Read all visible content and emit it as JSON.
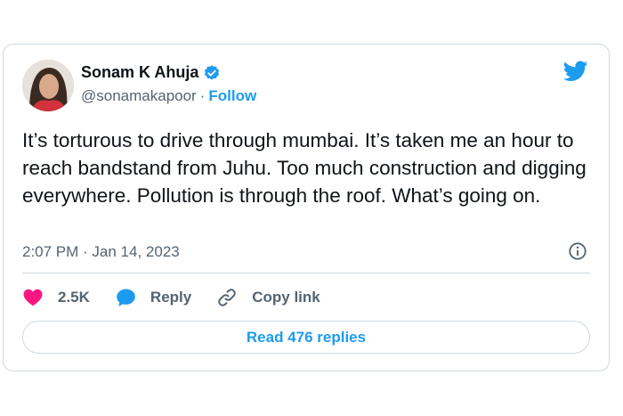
{
  "author": {
    "name": "Sonam K Ahuja",
    "handle": "@sonamakapoor",
    "separator": "·",
    "follow_label": "Follow"
  },
  "tweet": {
    "text": "It’s torturous to drive through mumbai. It’s taken me an hour to reach bandstand from Juhu. Too much construction and digging everywhere. Pollution is through the roof. What’s going on.",
    "timestamp": "2:07 PM · Jan 14, 2023"
  },
  "actions": {
    "likes_count": "2.5K",
    "reply_label": "Reply",
    "copy_link_label": "Copy link"
  },
  "read_replies_label": "Read 476 replies",
  "colors": {
    "accent": "#1d9bf0",
    "like": "#f91880",
    "text": "#0f1419",
    "muted": "#536471",
    "border": "#cfd9de"
  },
  "icons": [
    "verified-badge-icon",
    "twitter-bird-icon",
    "info-icon",
    "heart-icon",
    "reply-icon",
    "link-icon"
  ]
}
